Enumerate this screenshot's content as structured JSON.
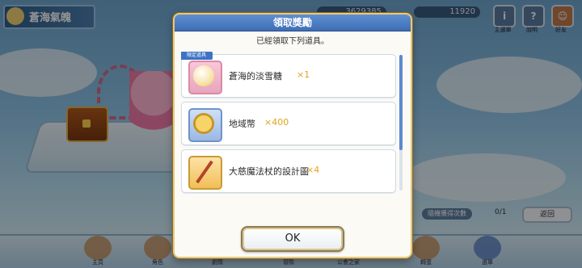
{
  "background": {
    "stage_title": "蒼海氣魄",
    "currencies": [
      "3629385",
      "11920"
    ],
    "header_buttons": [
      "主選單",
      "說明",
      "好友"
    ],
    "bottom_nav": [
      "主頁",
      "角色",
      "劇情",
      "冒險",
      "公會之家",
      "轉蛋",
      "選單"
    ],
    "side_pill_label": "隨機獲得次數",
    "side_count": "0/1",
    "back_button": "返回"
  },
  "modal": {
    "title": "領取獎勵",
    "subtitle": "已經領取下列道具。",
    "items": [
      {
        "name": "蒼海的淡雪糖",
        "qty": "×1",
        "badge": "限定道具",
        "icon": "candy-orb-icon"
      },
      {
        "name": "地域幣",
        "qty": "×400",
        "badge": "",
        "icon": "coin-icon"
      },
      {
        "name": "大慈魔法杖的設計圖",
        "qty": "×4",
        "badge": "",
        "icon": "staff-blueprint-icon"
      }
    ],
    "ok_label": "OK"
  },
  "colors": {
    "header_blue": "#4a7cc2",
    "qty_gold": "#e0a31a",
    "border_gold": "#e8c97a"
  }
}
